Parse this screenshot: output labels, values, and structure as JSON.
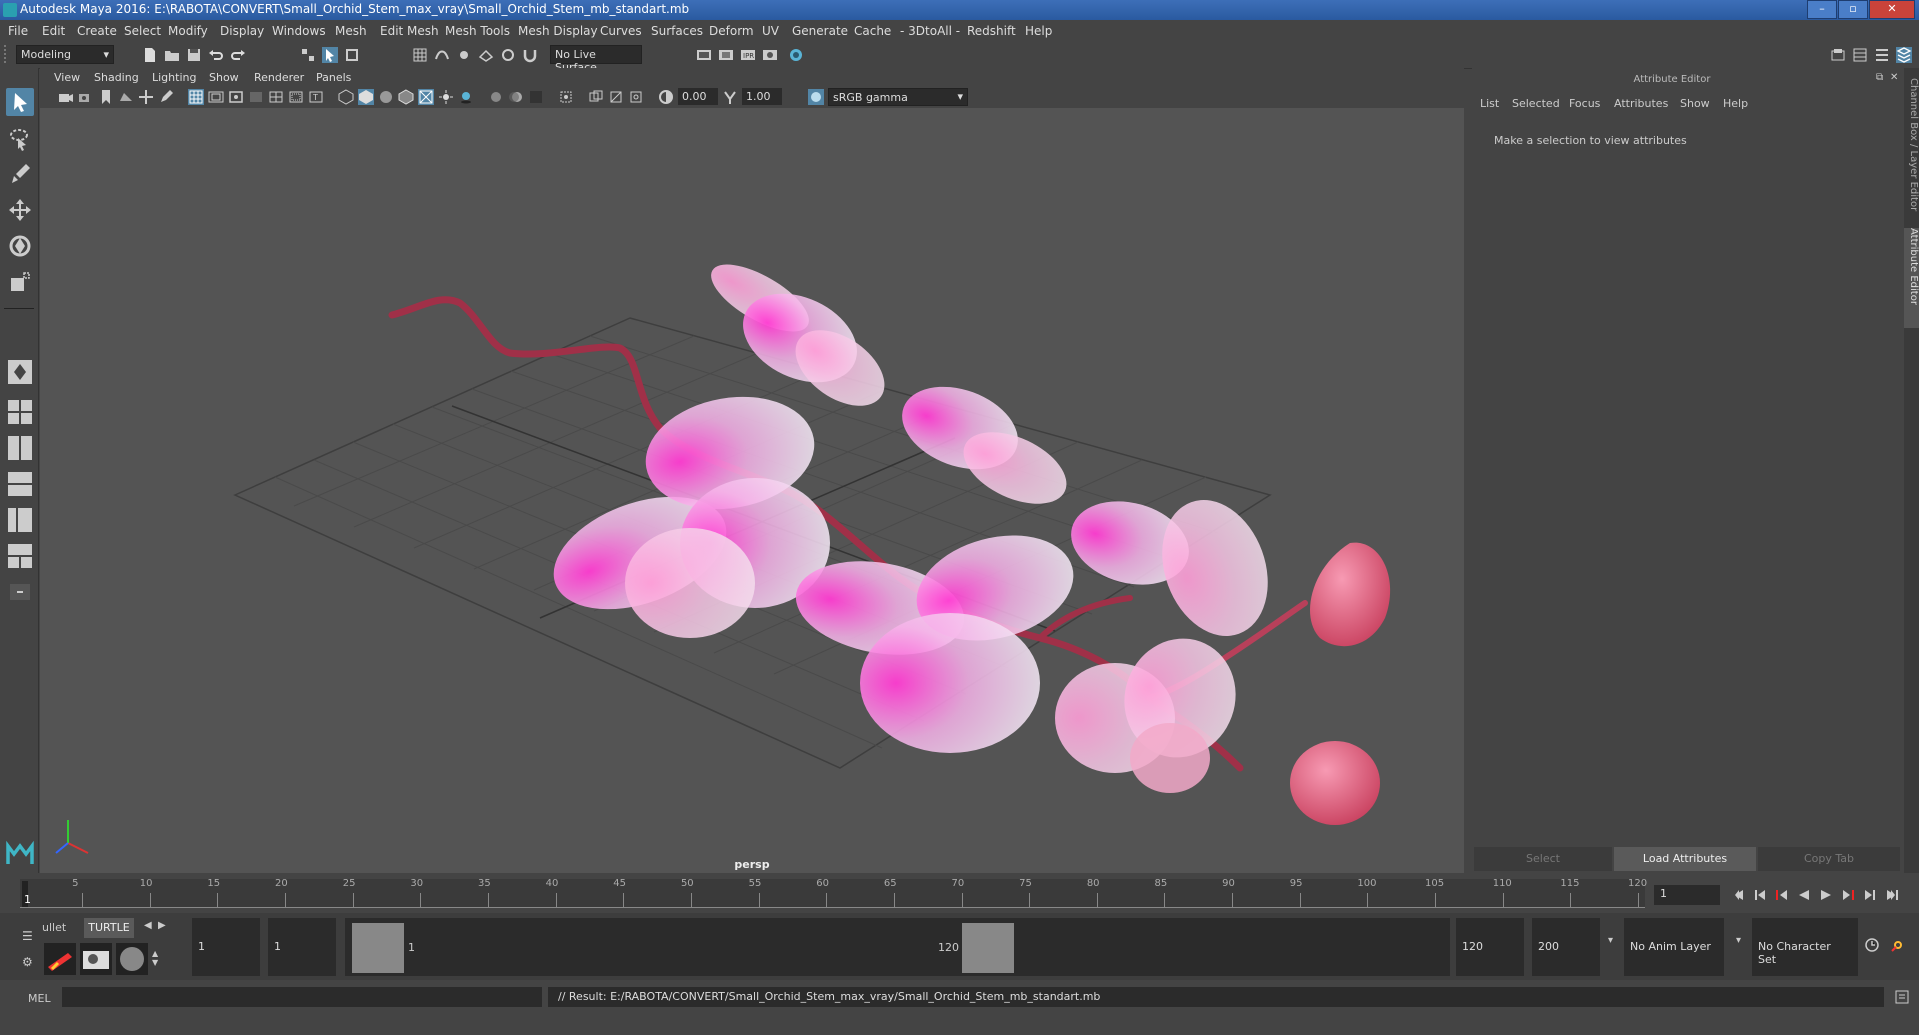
{
  "window": {
    "title": "Autodesk Maya 2016: E:\\RABOTA\\CONVERT\\Small_Orchid_Stem_max_vray\\Small_Orchid_Stem_mb_standart.mb"
  },
  "menu": [
    "File",
    "Edit",
    "Create",
    "Select",
    "Modify",
    "Display",
    "Windows",
    "Mesh",
    "Edit Mesh",
    "Mesh Tools",
    "Mesh Display",
    "Curves",
    "Surfaces",
    "Deform",
    "UV",
    "Generate",
    "Cache",
    "- 3DtoAll -",
    "Redshift",
    "Help"
  ],
  "shelf": {
    "mode": "Modeling",
    "live_surface": "No Live Surface"
  },
  "panel_menu": [
    "View",
    "Shading",
    "Lighting",
    "Show",
    "Renderer",
    "Panels"
  ],
  "panel_toolbar": {
    "exposure": "0.00",
    "gamma": "1.00",
    "color_space": "sRGB gamma"
  },
  "viewport": {
    "camera": "persp"
  },
  "attribute_editor": {
    "header": "Attribute Editor",
    "menu": [
      "List",
      "Selected",
      "Focus",
      "Attributes",
      "Show",
      "Help"
    ],
    "message": "Make a selection to view attributes",
    "buttons": {
      "select": "Select",
      "load": "Load Attributes",
      "copy": "Copy Tab"
    }
  },
  "side_tabs": {
    "channel": "Channel Box / Layer Editor",
    "attr": "Attribute Editor"
  },
  "timeline": {
    "ticks": [
      "1",
      "5",
      "10",
      "15",
      "20",
      "25",
      "30",
      "35",
      "40",
      "45",
      "50",
      "55",
      "60",
      "65",
      "70",
      "75",
      "80",
      "85",
      "90",
      "95",
      "100",
      "105",
      "110",
      "115",
      "120"
    ],
    "current_frame": "1",
    "current_marker": "1"
  },
  "range": {
    "shelf_tabs": {
      "bullet": "ullet",
      "turtle": "TURTLE"
    },
    "start": "1",
    "playback_start": "1",
    "slider_start": "1",
    "slider_end": "120",
    "playback_end": "120",
    "end": "200",
    "anim_layer": "No Anim Layer",
    "char_set": "No Character Set"
  },
  "command": {
    "lang": "MEL",
    "result": "// Result: E:/RABOTA/CONVERT/Small_Orchid_Stem_max_vray/Small_Orchid_Stem_mb_standart.mb"
  },
  "colors": {
    "accent": "#5285a6",
    "petal_pink": "#ff3cd2",
    "stem": "#a03048"
  }
}
